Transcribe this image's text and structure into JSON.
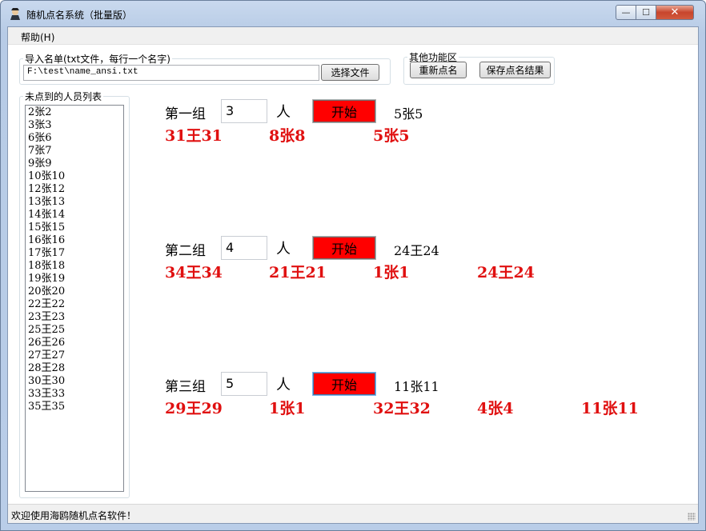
{
  "window": {
    "title": "随机点名系统（批量版）",
    "min_glyph": "—",
    "max_glyph": "☐",
    "close_glyph": "✕"
  },
  "menu": {
    "help": "帮助(H)"
  },
  "import": {
    "legend": "导入名单(txt文件，每行一个名字)",
    "path": "F:\\test\\name_ansi.txt",
    "choose_label": "选择文件"
  },
  "other": {
    "legend": "其他功能区",
    "reset_label": "重新点名",
    "save_label": "保存点名结果"
  },
  "list": {
    "legend": "未点到的人员列表",
    "items": [
      "2张2",
      "3张3",
      "6张6",
      "7张7",
      "9张9",
      "10张10",
      "12张12",
      "13张13",
      "14张14",
      "15张15",
      "16张16",
      "17张17",
      "18张18",
      "19张19",
      "20张20",
      "22王22",
      "23王23",
      "25王25",
      "26王26",
      "27王27",
      "28王28",
      "30王30",
      "33王33",
      "35王35"
    ]
  },
  "groups": [
    {
      "label": "第一组",
      "count": "3",
      "unit": "人",
      "start": "开始",
      "current": "5张5",
      "results": [
        "31王31",
        "8张8",
        "5张5"
      ]
    },
    {
      "label": "第二组",
      "count": "4",
      "unit": "人",
      "start": "开始",
      "current": "24王24",
      "results": [
        "34王34",
        "21王21",
        "1张1",
        "24王24"
      ]
    },
    {
      "label": "第三组",
      "count": "5",
      "unit": "人",
      "start": "开始",
      "current": "11张11",
      "results": [
        "29王29",
        "1张1",
        "32王32",
        "4张4",
        "11张11"
      ]
    }
  ],
  "status": {
    "text": "欢迎使用海鸥随机点名软件！"
  },
  "colors": {
    "start_button": "#ff0000",
    "result_text": "#e01010"
  }
}
